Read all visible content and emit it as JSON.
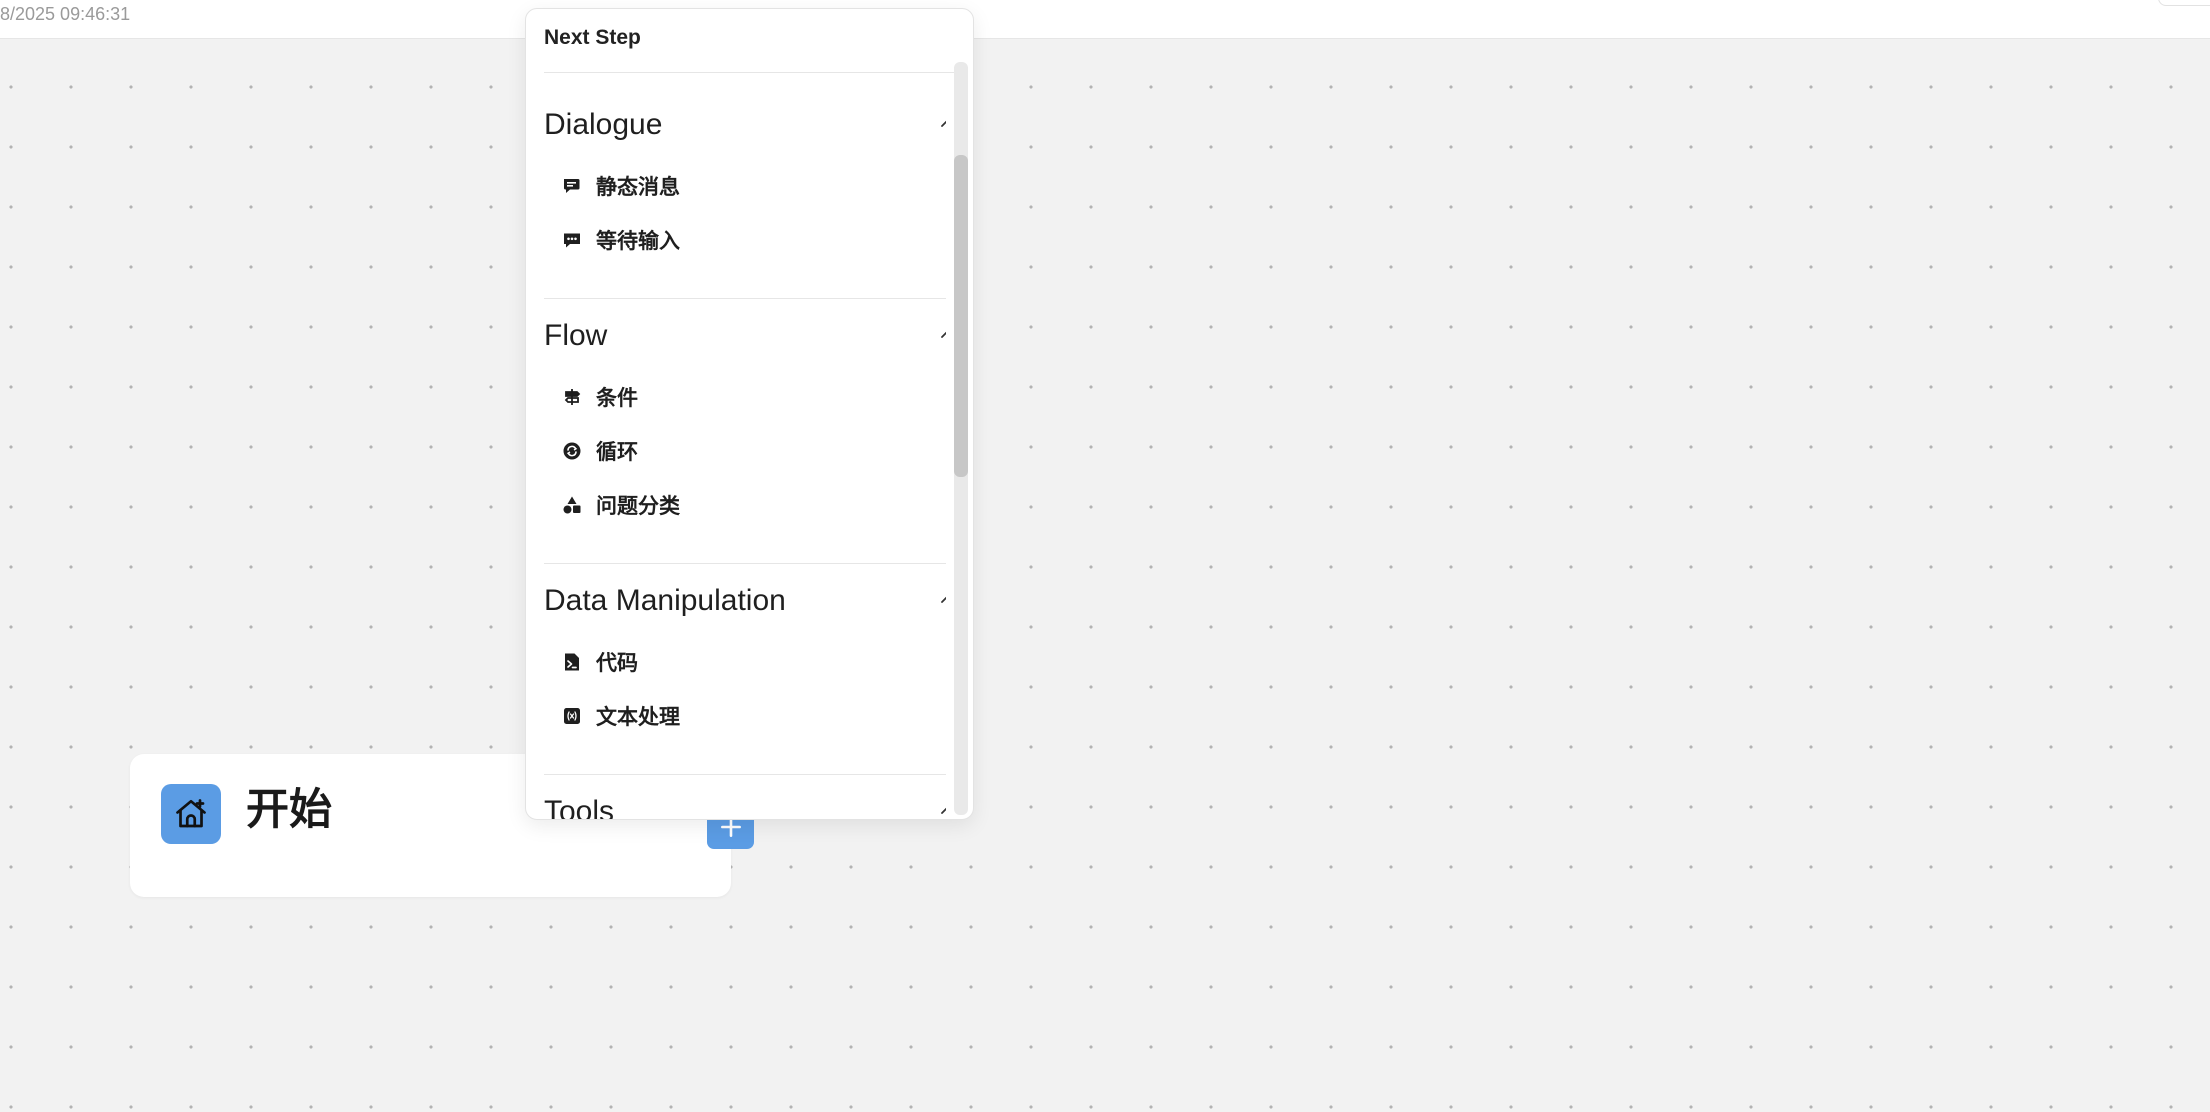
{
  "topbar": {
    "timestamp": "8/2025 09:46:31"
  },
  "start_node": {
    "title": "开始",
    "icon": "home-plus-icon",
    "add_button_icon": "plus-icon",
    "accent_color": "#5b9ce4"
  },
  "next_step": {
    "title": "Next Step",
    "categories": [
      {
        "title": "Dialogue",
        "expanded": true,
        "items": [
          {
            "label": "静态消息",
            "icon": "chat-message-icon"
          },
          {
            "label": "等待输入",
            "icon": "chat-typing-icon"
          }
        ]
      },
      {
        "title": "Flow",
        "expanded": true,
        "items": [
          {
            "label": "条件",
            "icon": "signpost-icon"
          },
          {
            "label": "循环",
            "icon": "loop-icon"
          },
          {
            "label": "问题分类",
            "icon": "shapes-icon"
          }
        ]
      },
      {
        "title": "Data Manipulation",
        "expanded": true,
        "items": [
          {
            "label": "代码",
            "icon": "code-file-icon"
          },
          {
            "label": "文本处理",
            "icon": "variable-icon"
          }
        ]
      },
      {
        "title": "Tools",
        "expanded": true,
        "items": []
      }
    ]
  }
}
